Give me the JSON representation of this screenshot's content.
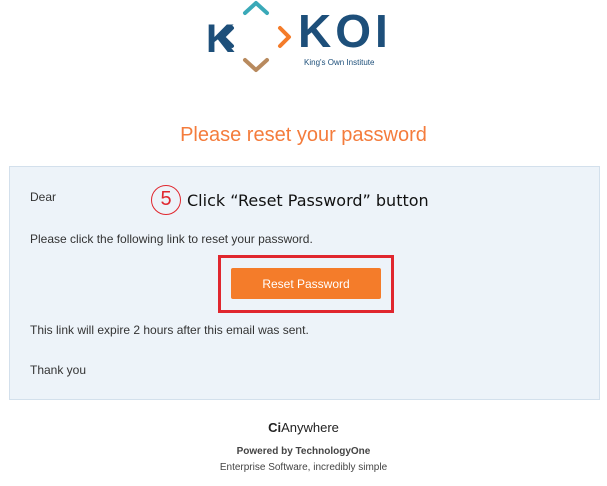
{
  "logo": {
    "mark_letter": "K",
    "name": "KOI",
    "tagline": "King's Own Institute"
  },
  "email": {
    "title": "Please reset your password",
    "greeting": "Dear",
    "instruction": "Please click the following link to reset your password.",
    "reset_button_label": "Reset Password",
    "expiry_note": "This link will expire 2 hours after this email was sent.",
    "sign_off": "Thank you"
  },
  "callout": {
    "step_number": "5",
    "text": "Click “Reset Password” button"
  },
  "footer": {
    "brand_ci": "Ci",
    "brand_rest": "Anywhere",
    "powered_by": "Powered by TechnologyOne",
    "tagline": "Enterprise Software, incredibly simple"
  },
  "colors": {
    "accent_orange": "#f47c2a",
    "title_orange": "#f47c3c",
    "annotation_red": "#e0262e",
    "koi_blue": "#1d4f7a",
    "koi_teal": "#3aa9b8",
    "koi_tan": "#b88a5e",
    "panel_bg": "#edf3f9"
  },
  "icons": {
    "logo_mark": "koi-diamond-chevrons-icon",
    "step_badge": "circled-number-icon"
  }
}
